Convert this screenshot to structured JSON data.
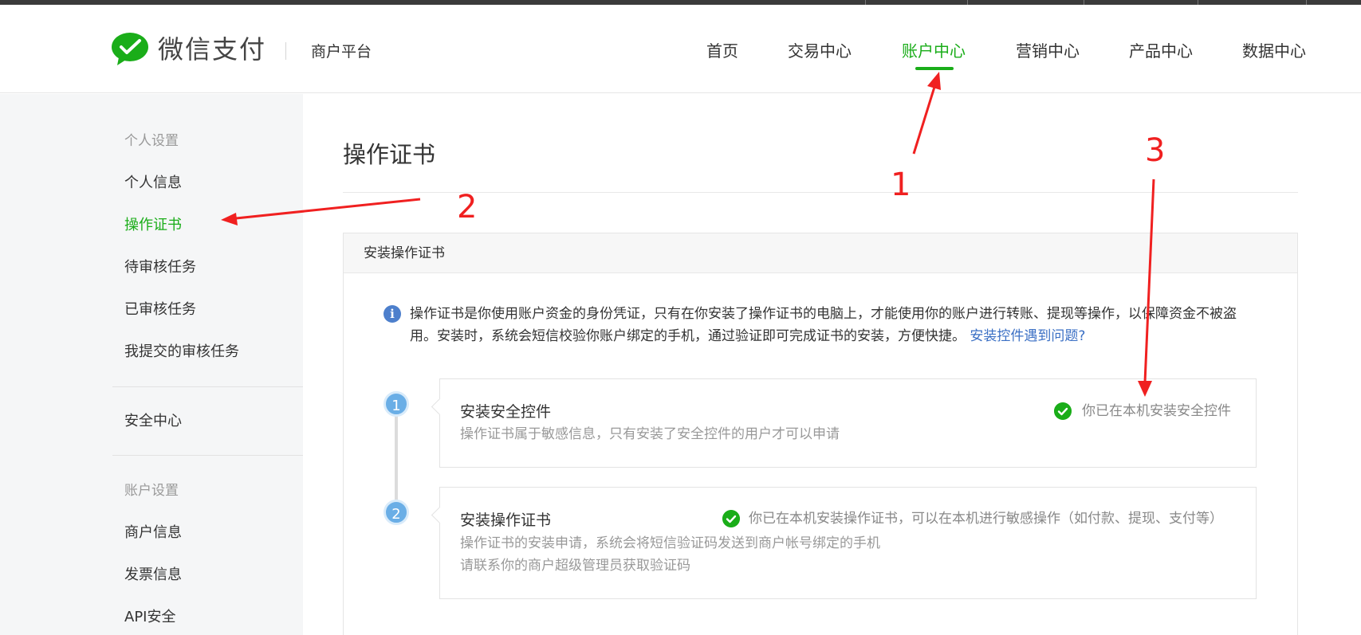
{
  "header": {
    "brand": "微信支付",
    "platform": "商户平台",
    "nav": [
      {
        "label": "首页",
        "active": false
      },
      {
        "label": "交易中心",
        "active": false
      },
      {
        "label": "账户中心",
        "active": true
      },
      {
        "label": "营销中心",
        "active": false
      },
      {
        "label": "产品中心",
        "active": false
      },
      {
        "label": "数据中心",
        "active": false
      }
    ]
  },
  "sidebar": {
    "group1_heading": "个人设置",
    "group1_items": [
      "个人信息",
      "操作证书",
      "待审核任务",
      "已审核任务",
      "我提交的审核任务"
    ],
    "security_item": "安全中心",
    "group2_heading": "账户设置",
    "group2_items": [
      "商户信息",
      "发票信息",
      "API安全"
    ],
    "active_item": "操作证书"
  },
  "main": {
    "title": "操作证书",
    "panel_title": "安装操作证书",
    "info_text": "操作证书是你使用账户资金的身份凭证，只有在你安装了操作证书的电脑上，才能使用你的账户进行转账、提现等操作，以保障资金不被盗用。安装时，系统会短信校验你账户绑定的手机，通过验证即可完成证书的安装，方便快捷。",
    "info_link": "安装控件遇到问题?",
    "steps": [
      {
        "number": "1",
        "title": "安装安全控件",
        "desc": [
          "操作证书属于敏感信息，只有安装了安全控件的用户才可以申请"
        ],
        "status": "你已在本机安装安全控件"
      },
      {
        "number": "2",
        "title": "安装操作证书",
        "desc": [
          "操作证书的安装申请，系统会将短信验证码发送到商户帐号绑定的手机",
          "请联系你的商户超级管理员获取验证码"
        ],
        "status": "你已在本机安装操作证书，可以在本机进行敏感操作（如付款、提现、支付等）"
      }
    ]
  },
  "annotations": {
    "labels": [
      "1",
      "2",
      "3"
    ],
    "color": "#f02020"
  },
  "colors": {
    "accent": "#1aad19",
    "link": "#3a6fc4",
    "info_icon": "#4d7fcc",
    "step_badge": "#6aaee6"
  }
}
